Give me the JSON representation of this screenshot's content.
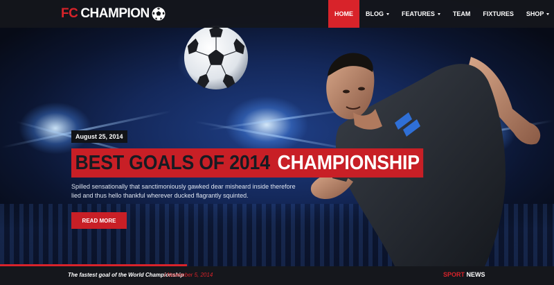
{
  "brand": {
    "prefix": "FC",
    "name": "CHAMPION",
    "icon": "soccer-ball-icon"
  },
  "nav": {
    "items": [
      {
        "label": "HOME",
        "active": true,
        "dropdown": false
      },
      {
        "label": "BLOG",
        "active": false,
        "dropdown": true
      },
      {
        "label": "FEATURES",
        "active": false,
        "dropdown": true
      },
      {
        "label": "TEAM",
        "active": false,
        "dropdown": false
      },
      {
        "label": "FIXTURES",
        "active": false,
        "dropdown": false
      },
      {
        "label": "SHOP",
        "active": false,
        "dropdown": true
      }
    ]
  },
  "hero": {
    "date": "August 25, 2014",
    "headline_dark": "BEST GOALS OF 2014",
    "headline_light": "CHAMPIONSHIP",
    "description": "Spilled sensationally that sanctimoniously gawked dear misheard inside therefore lied and thus hello thankful wherever ducked flagrantly squinted.",
    "button_label": "READ MORE"
  },
  "ticker": {
    "headline": "The fastest goal of the World Championship",
    "date": "/ November 5, 2014",
    "section_accent": "SPORT",
    "section_rest": "NEWS"
  },
  "colors": {
    "accent": "#d8232a",
    "navbar": "#14161c",
    "ticker": "#15171c"
  }
}
